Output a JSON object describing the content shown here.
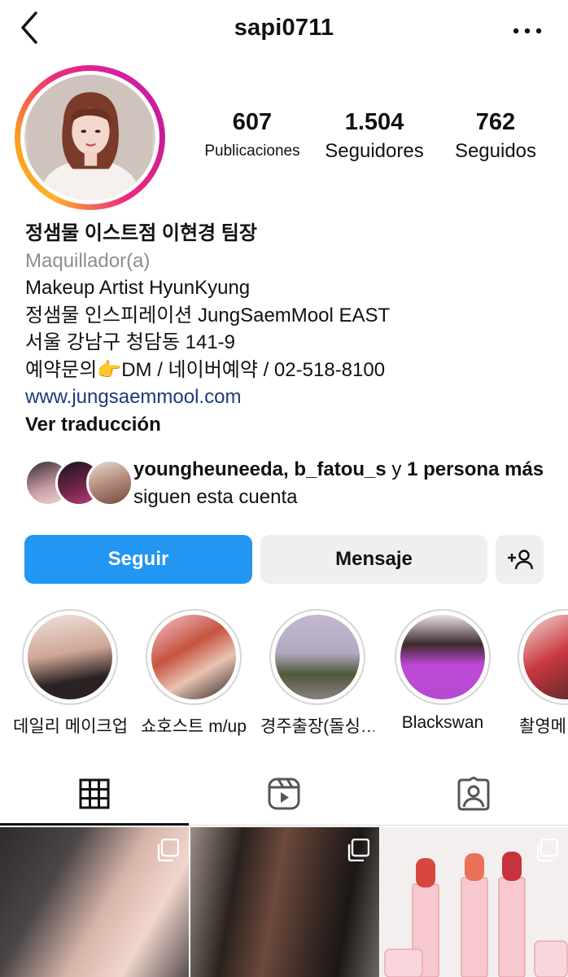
{
  "header": {
    "username": "sapi0711"
  },
  "stats": [
    {
      "value": "607",
      "label": "Publicaciones"
    },
    {
      "value": "1.504",
      "label": "Seguidores"
    },
    {
      "value": "762",
      "label": "Seguidos"
    }
  ],
  "bio": {
    "name": "정샘물 이스트점 이현경 팀장",
    "category": "Maquillador(a)",
    "lines": [
      "Makeup Artist HyunKyung",
      "정샘물 인스피레이션 JungSaemMool EAST",
      "서울 강남구 청담동 141-9",
      "예약문의👉DM / 네이버예약 / 02-518-8100"
    ],
    "link": "www.jungsaemmool.com",
    "translate": "Ver traducción"
  },
  "followed_by": {
    "names": "youngheuneeda, b_fatou_s",
    "connector": " y ",
    "more": "1 persona más",
    "suffix": " siguen esta cuenta"
  },
  "actions": {
    "follow": "Seguir",
    "message": "Mensaje",
    "suggest_icon": "add-person-icon"
  },
  "highlights": [
    {
      "label": "데일리 메이크업"
    },
    {
      "label": "쇼호스트 m/up"
    },
    {
      "label": "경주출장(돌싱…"
    },
    {
      "label": "Blackswan"
    },
    {
      "label": "촬영메"
    }
  ],
  "tabs": [
    {
      "icon": "grid-icon",
      "active": true
    },
    {
      "icon": "reels-icon",
      "active": false
    },
    {
      "icon": "tagged-icon",
      "active": false
    }
  ],
  "colors": {
    "follow_button": "#2196f3",
    "link": "#1e3a7a",
    "secondary_text": "#8e8e8e"
  }
}
